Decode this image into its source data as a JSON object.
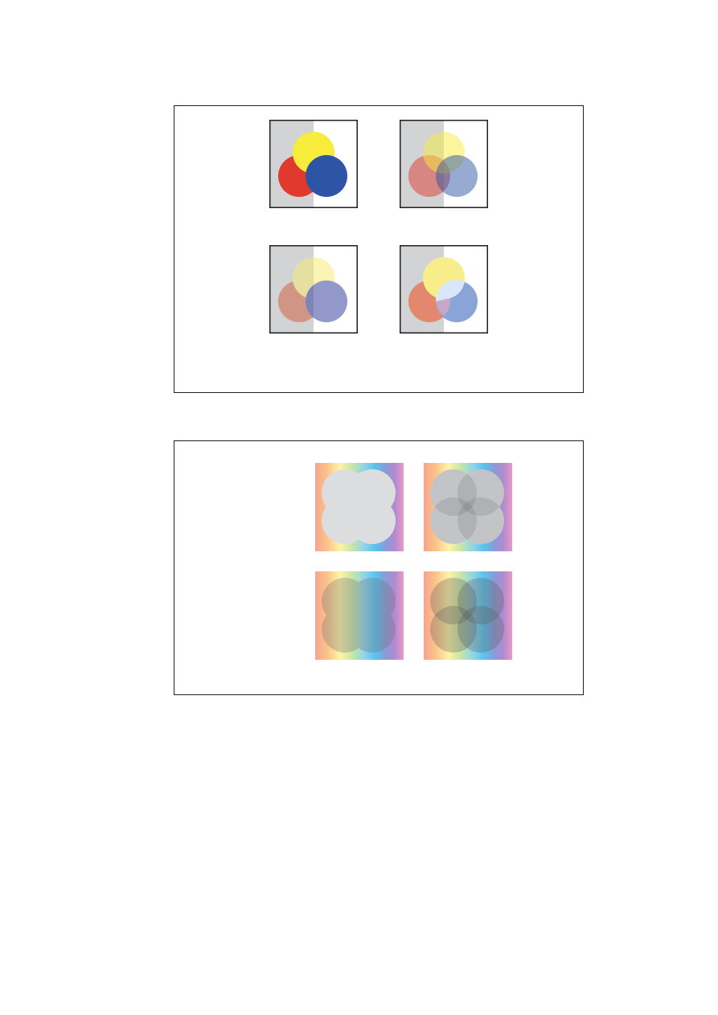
{
  "figures": [
    {
      "id": "transparency-group-demo",
      "panels": [
        {
          "variant": "opaque"
        },
        {
          "variant": "transparent-overlapping"
        },
        {
          "variant": "knockout-group"
        },
        {
          "variant": "non-isolated-group"
        }
      ],
      "colors": {
        "backdrop_gray": "#d1d3d4",
        "yellow": "#f7eb3c",
        "red": "#e03a2e",
        "blue": "#2e55a5",
        "yellow_light": "#f9f1a4",
        "red_light": "#de8d78",
        "blue_light": "#8f95c9",
        "frame": "#231f20"
      }
    },
    {
      "id": "rainbow-backdrop-demo",
      "panels": [
        {
          "variant": "opaque-gray"
        },
        {
          "variant": "transparent-gray"
        },
        {
          "variant": "knockout-dark"
        },
        {
          "variant": "overlapping-dark"
        }
      ],
      "colors": {
        "circle_gray": "#dcdddf",
        "rainbow": [
          "#f7a48e",
          "#fbc58a",
          "#fff3a6",
          "#c7e6a8",
          "#8fd3e8",
          "#58c3ef",
          "#8a9bd6",
          "#b18ad0",
          "#e99ac8"
        ]
      }
    }
  ]
}
